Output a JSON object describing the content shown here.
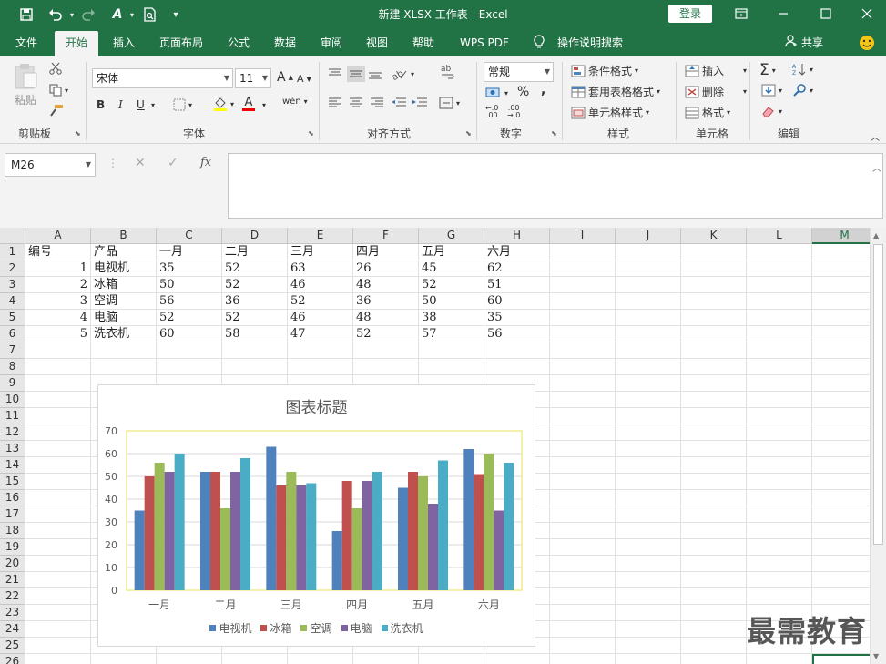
{
  "window": {
    "title": "新建 XLSX 工作表 - Excel",
    "login_label": "登录",
    "quick_access": [
      "save-icon",
      "undo-icon",
      "redo-icon",
      "format-painter-icon",
      "print-preview-icon",
      "customize-icon"
    ],
    "controls": [
      "ribbon-display-icon",
      "minimize-icon",
      "maximize-icon",
      "close-icon"
    ]
  },
  "tabs": {
    "items": [
      "文件",
      "开始",
      "插入",
      "页面布局",
      "公式",
      "数据",
      "审阅",
      "视图",
      "帮助",
      "WPS PDF"
    ],
    "active": "开始",
    "tell_me": "操作说明搜索",
    "share": "共享"
  },
  "ribbon": {
    "clipboard": {
      "label": "剪贴板",
      "paste": "粘贴"
    },
    "font": {
      "label": "字体",
      "font_name": "宋体",
      "font_size": "11",
      "bold": "B",
      "italic": "I",
      "underline": "U"
    },
    "alignment": {
      "label": "对齐方式"
    },
    "number": {
      "label": "数字",
      "format": "常规"
    },
    "styles": {
      "label": "样式",
      "conditional": "条件格式",
      "table": "套用表格格式",
      "cell_styles": "单元格样式"
    },
    "cells": {
      "label": "单元格",
      "insert": "插入",
      "delete": "删除",
      "format": "格式"
    },
    "editing": {
      "label": "编辑"
    }
  },
  "formula_bar": {
    "name_box": "M26",
    "fx": "fx",
    "content": ""
  },
  "sheet": {
    "columns": [
      "A",
      "B",
      "C",
      "D",
      "E",
      "F",
      "G",
      "H",
      "I",
      "J",
      "K",
      "L",
      "M"
    ],
    "selected_column": "M",
    "rows": [
      "1",
      "2",
      "3",
      "4",
      "5",
      "6",
      "7",
      "8",
      "9",
      "10",
      "11",
      "12",
      "13",
      "14",
      "15",
      "16",
      "17",
      "18",
      "19",
      "20",
      "21",
      "22",
      "23",
      "24",
      "25",
      "26"
    ],
    "data": [
      [
        "编号",
        "产品",
        "一月",
        "二月",
        "三月",
        "四月",
        "五月",
        "六月"
      ],
      [
        "1",
        "电视机",
        "35",
        "52",
        "63",
        "26",
        "45",
        "62"
      ],
      [
        "2",
        "冰箱",
        "50",
        "52",
        "46",
        "48",
        "52",
        "51"
      ],
      [
        "3",
        "空调",
        "56",
        "36",
        "52",
        "36",
        "50",
        "60"
      ],
      [
        "4",
        "电脑",
        "52",
        "52",
        "46",
        "48",
        "38",
        "35"
      ],
      [
        "5",
        "洗衣机",
        "60",
        "58",
        "47",
        "52",
        "57",
        "56"
      ]
    ]
  },
  "chart_data": {
    "type": "bar",
    "title": "图表标题",
    "categories": [
      "一月",
      "二月",
      "三月",
      "四月",
      "五月",
      "六月"
    ],
    "series": [
      {
        "name": "电视机",
        "color": "#4f81bd",
        "values": [
          35,
          52,
          63,
          26,
          45,
          62
        ]
      },
      {
        "name": "冰箱",
        "color": "#c0504d",
        "values": [
          50,
          52,
          46,
          48,
          52,
          51
        ]
      },
      {
        "name": "空调",
        "color": "#9bbb59",
        "values": [
          56,
          36,
          52,
          36,
          50,
          60
        ]
      },
      {
        "name": "电脑",
        "color": "#8064a2",
        "values": [
          52,
          52,
          46,
          48,
          38,
          35
        ]
      },
      {
        "name": "洗衣机",
        "color": "#4bacc6",
        "values": [
          60,
          58,
          47,
          52,
          57,
          56
        ]
      }
    ],
    "ylim": [
      0,
      70
    ],
    "yticks": [
      "0",
      "10",
      "20",
      "30",
      "40",
      "50",
      "60",
      "70"
    ],
    "grid": true,
    "legend": "bottom"
  },
  "watermark": "最需教育",
  "colors": {
    "accent": "#217346"
  }
}
